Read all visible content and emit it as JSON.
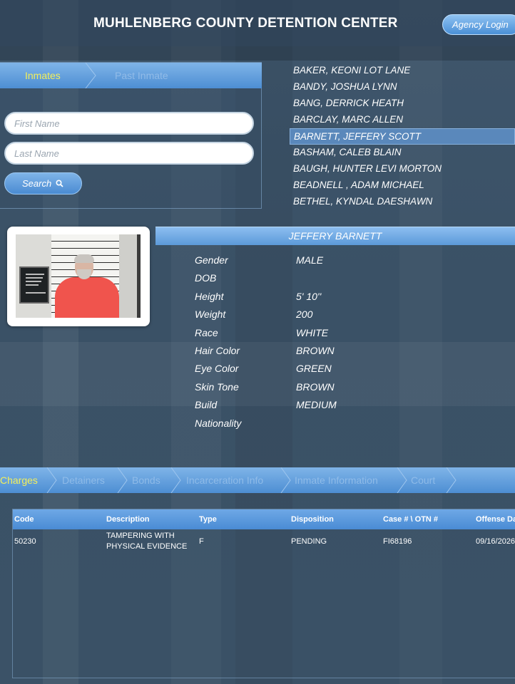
{
  "header": {
    "title": "MUHLENBERG COUNTY DETENTION CENTER",
    "agency_login": "Agency Login"
  },
  "search": {
    "tabs": [
      {
        "label": "Inmates",
        "active": true
      },
      {
        "label": "Past Inmate",
        "active": false
      }
    ],
    "first_name_placeholder": "First Name",
    "last_name_placeholder": "Last Name",
    "search_label": "Search"
  },
  "inmates": [
    "BAKER, KEONI LOT LANE",
    "BANDY, JOSHUA LYNN",
    "BANG, DERRICK HEATH",
    "BARCLAY, MARC ALLEN",
    "BARNETT, JEFFERY SCOTT",
    "BASHAM, CALEB BLAIN",
    "BAUGH, HUNTER LEVI MORTON",
    "BEADNELL , ADAM MICHAEL",
    "BETHEL, KYNDAL DAESHAWN"
  ],
  "selected_index": 4,
  "profile": {
    "name": "JEFFERY BARNETT",
    "details": [
      {
        "label": "Gender",
        "value": "MALE"
      },
      {
        "label": "DOB",
        "value": ""
      },
      {
        "label": "Height",
        "value": "5' 10''"
      },
      {
        "label": "Weight",
        "value": "200"
      },
      {
        "label": "Race",
        "value": "WHITE"
      },
      {
        "label": "Hair Color",
        "value": "BROWN"
      },
      {
        "label": "Eye Color",
        "value": "GREEN"
      },
      {
        "label": "Skin Tone",
        "value": "BROWN"
      },
      {
        "label": "Build",
        "value": "MEDIUM"
      },
      {
        "label": "Nationality",
        "value": ""
      }
    ]
  },
  "detail_tabs": [
    {
      "label": "Charges",
      "active": true
    },
    {
      "label": "Detainers",
      "active": false
    },
    {
      "label": "Bonds",
      "active": false
    },
    {
      "label": "Incarceration Info",
      "active": false
    },
    {
      "label": "Inmate Information",
      "active": false
    },
    {
      "label": "Court",
      "active": false
    }
  ],
  "charges": {
    "columns": [
      "Code",
      "Description",
      "Type",
      "Disposition",
      "Case # \\ OTN #",
      "Offense Date"
    ],
    "rows": [
      {
        "code": "50230",
        "description_line1": "TAMPERING WITH",
        "description_line2": "PHYSICAL EVIDENCE",
        "type": "F",
        "disposition": "PENDING",
        "case": "FI68196",
        "offense_date": "09/16/2026"
      }
    ]
  },
  "colors": {
    "accent_blue": "#4d8ed3",
    "active_tab_text": "#f3ef5a",
    "selected_row": "#5a88bb",
    "background": "#3d5469"
  }
}
